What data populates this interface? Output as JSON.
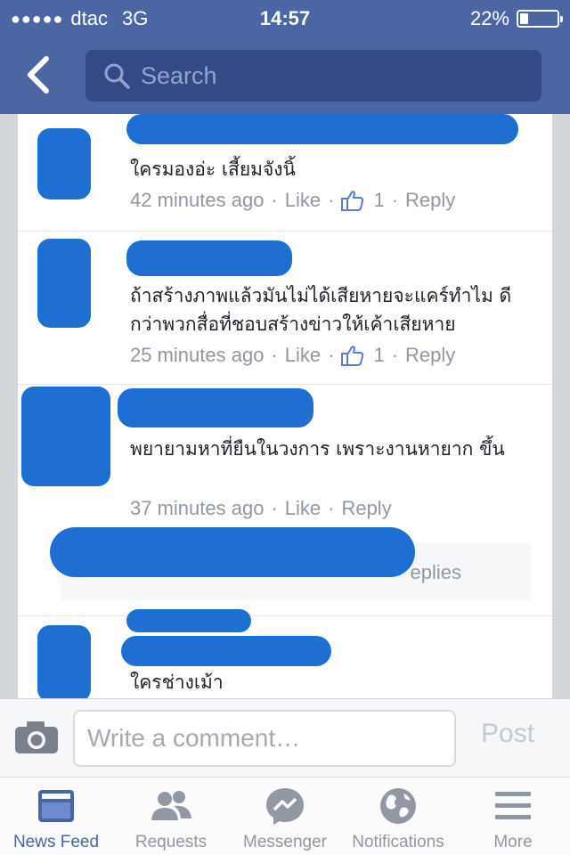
{
  "status_bar": {
    "signal": "●●●●●",
    "carrier": "dtac",
    "network": "3G",
    "time": "14:57",
    "battery_text": "22%",
    "battery_level": 0.22
  },
  "header": {
    "search_placeholder": "Search"
  },
  "comments": [
    {
      "text": "ใครมองอ่ะ เสี้ยมจังนิ้",
      "time": "42 minutes ago",
      "like_label": "Like",
      "like_count": "1",
      "reply_label": "Reply"
    },
    {
      "text": "ถ้าสร้างภาพแล้วมันไม่ได้เสียหายจะแคร์ทำไม ดีกว่าพวกสื่อที่ชอบสร้างข่าวให้เค้าเสียหาย",
      "time": "25 minutes ago",
      "like_label": "Like",
      "like_count": "1",
      "reply_label": "Reply"
    },
    {
      "text": "พยายามหาที่ยืนในวงการ เพราะงานหายาก ขึ้น",
      "time": "37 minutes ago",
      "like_label": "Like",
      "reply_label": "Reply"
    },
    {
      "text": "ใครช่างเม้า"
    }
  ],
  "replies_text": "eplies",
  "composer": {
    "placeholder": "Write a comment…",
    "post_label": "Post"
  },
  "tabs": [
    {
      "label": "News Feed",
      "icon": "news-feed-icon"
    },
    {
      "label": "Requests",
      "icon": "friend-requests-icon"
    },
    {
      "label": "Messenger",
      "icon": "messenger-icon"
    },
    {
      "label": "Notifications",
      "icon": "globe-icon"
    },
    {
      "label": "More",
      "icon": "menu-icon"
    }
  ],
  "colors": {
    "header": "#4c66a4",
    "search_bg": "#344a87",
    "redaction": "#1f6ed1",
    "active_tab": "#4c66a4",
    "muted": "#9197a3"
  }
}
